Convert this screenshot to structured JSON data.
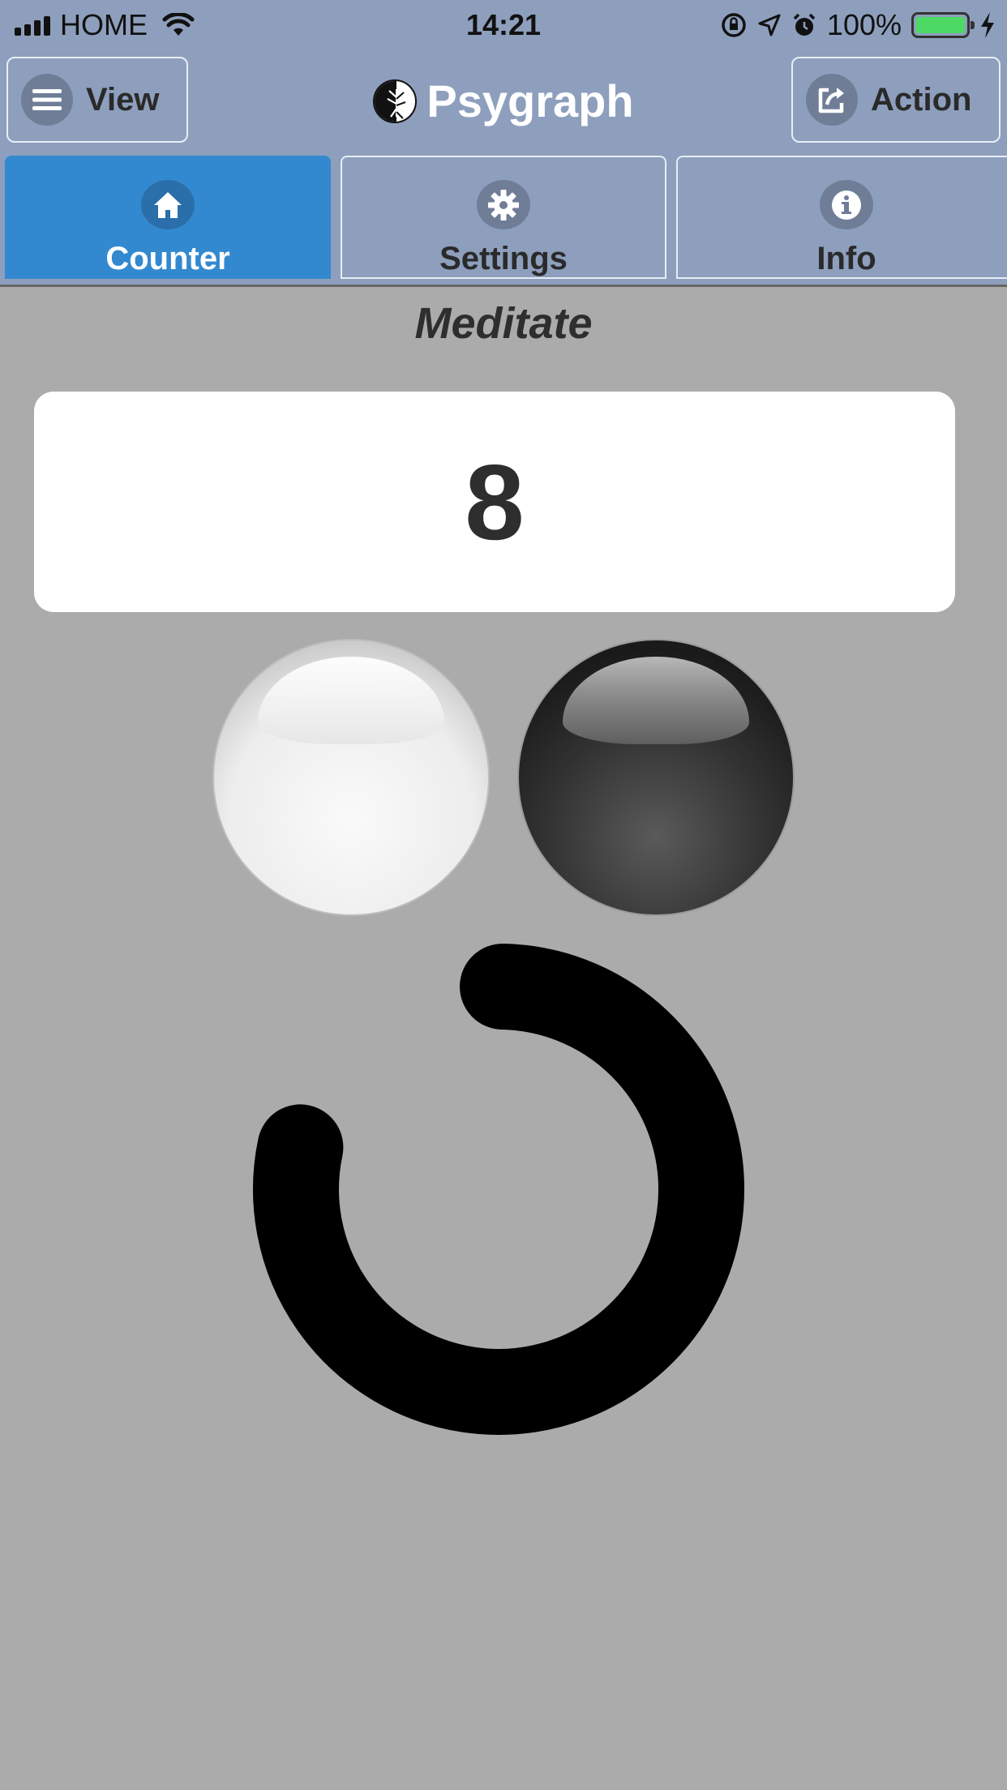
{
  "status_bar": {
    "carrier": "HOME",
    "time": "14:21",
    "battery": "100%"
  },
  "header": {
    "view_label": "View",
    "app_title": "Psygraph",
    "action_label": "Action"
  },
  "tabs": [
    {
      "label": "Counter",
      "icon": "home-icon",
      "active": true
    },
    {
      "label": "Settings",
      "icon": "gear-icon",
      "active": false
    },
    {
      "label": "Info",
      "icon": "info-icon",
      "active": false
    }
  ],
  "main": {
    "title": "Meditate",
    "count": "8",
    "orbs": [
      "white-orb",
      "black-orb"
    ],
    "progress_fraction": 0.78
  },
  "colors": {
    "bar_bg": "#8d9fbd",
    "active_tab": "#3389cf",
    "page_bg": "#ababab",
    "battery": "#4cd964"
  }
}
